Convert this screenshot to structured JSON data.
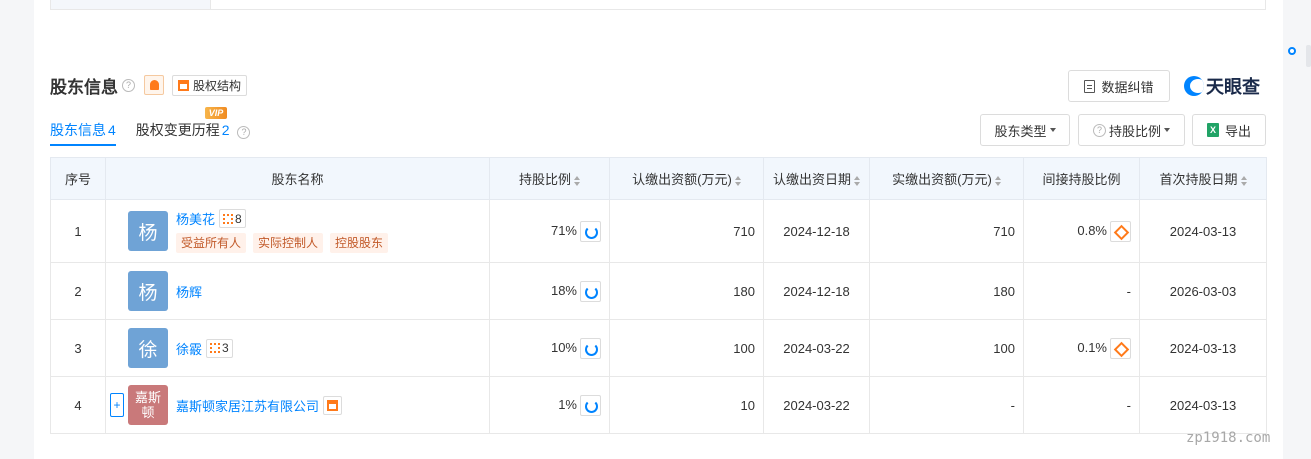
{
  "section": {
    "title": "股东信息",
    "struct_label": "股权结构",
    "correct_label": "数据纠错",
    "brand": "天眼查"
  },
  "tabs": [
    {
      "label": "股东信息",
      "count": "4"
    },
    {
      "label": "股权变更历程",
      "count": "2",
      "badge": "VIP"
    }
  ],
  "toolbar": {
    "holder_type": "股东类型",
    "ratio": "持股比例",
    "export": "导出",
    "excel_glyph": "X"
  },
  "table": {
    "headers": [
      "序号",
      "股东名称",
      "持股比例",
      "认缴出资额(万元)",
      "认缴出资日期",
      "实缴出资额(万元)",
      "间接持股比例",
      "首次持股日期"
    ],
    "rows": [
      {
        "idx": "1",
        "avatar": "杨",
        "avatar_color": "#6fa3d6",
        "name": "杨美花",
        "rel_count": "8",
        "tags": [
          "受益所有人",
          "实际控制人",
          "控股股东"
        ],
        "ratio": "71%",
        "sub_amt": "710",
        "sub_date": "2024-12-18",
        "paid_amt": "710",
        "indirect": "0.8%",
        "first_date": "2024-03-13"
      },
      {
        "idx": "2",
        "avatar": "杨",
        "avatar_color": "#6fa3d6",
        "name": "杨辉",
        "ratio": "18%",
        "sub_amt": "180",
        "sub_date": "2024-12-18",
        "paid_amt": "180",
        "indirect": "-",
        "first_date": "2026-03-03"
      },
      {
        "idx": "3",
        "avatar": "徐",
        "avatar_color": "#6fa3d6",
        "name": "徐霰",
        "rel_count": "3",
        "ratio": "10%",
        "sub_amt": "100",
        "sub_date": "2024-03-22",
        "paid_amt": "100",
        "indirect": "0.1%",
        "first_date": "2024-03-13"
      },
      {
        "idx": "4",
        "avatar": "嘉斯顿",
        "avatar_color": "#c9797a",
        "name": "嘉斯顿家居江苏有限公司",
        "expand": "+",
        "ratio": "1%",
        "sub_amt": "10",
        "sub_date": "2024-03-22",
        "paid_amt": "-",
        "indirect": "-",
        "first_date": "2024-03-13"
      }
    ]
  },
  "watermark": "zp1918.com",
  "colors": {
    "accent": "#0084ff",
    "orange": "#ff7a1a",
    "header_bg": "#f2f7fd"
  }
}
